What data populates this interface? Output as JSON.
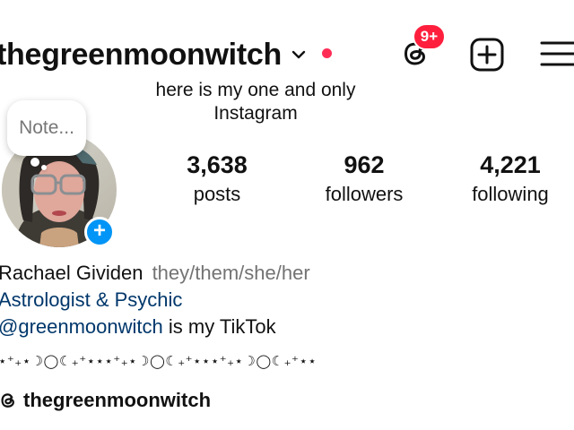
{
  "header": {
    "username": "thegreenmoonwitch",
    "notification_badge": "9+",
    "icons": [
      "chevron-down-icon",
      "threads-icon",
      "create-plus-icon",
      "menu-icon"
    ]
  },
  "headline": {
    "line1": "here is my one and only",
    "line2": "Instagram"
  },
  "note": {
    "placeholder": "Note..."
  },
  "stats": {
    "posts": {
      "value": "3,638",
      "label": "posts"
    },
    "followers": {
      "value": "962",
      "label": "followers"
    },
    "following": {
      "value": "4,221",
      "label": "following"
    }
  },
  "bio": {
    "name": "Rachael Gividen",
    "pronouns": "they/them/she/her",
    "category": "Astrologist & Psychic",
    "mention": "@greenmoonwitch",
    "mention_suffix": " is my TikTok",
    "decoration": "⋆⁺₊⋆☽◯☾₊⁺⋆⋆⋆⁺₊⋆☽◯☾₊⁺⋆⋆⋆⁺₊⋆☽◯☾₊⁺⋆⋆"
  },
  "threads_link": {
    "label": "thegreenmoonwitch"
  },
  "colors": {
    "badge": "#ff1f3d",
    "dot": "#ff2d55",
    "link": "#00376b",
    "add_story": "#0095f6",
    "secondary_text": "#737373"
  }
}
